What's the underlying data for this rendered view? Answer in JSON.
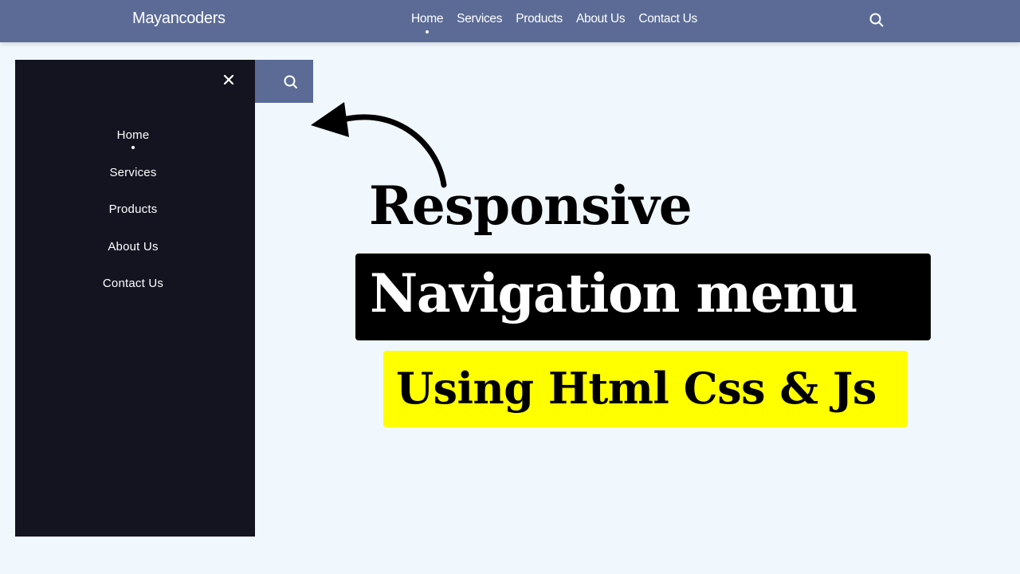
{
  "header": {
    "logo": "Mayancoders",
    "nav": [
      {
        "label": "Home",
        "active": true
      },
      {
        "label": "Services",
        "active": false
      },
      {
        "label": "Products",
        "active": false
      },
      {
        "label": "About Us",
        "active": false
      },
      {
        "label": "Contact Us",
        "active": false
      }
    ],
    "search_icon": "search-icon",
    "background": "#5b6b96"
  },
  "drawer": {
    "close_icon": "close-icon",
    "items": [
      {
        "label": "Home",
        "active": true
      },
      {
        "label": "Services",
        "active": false
      },
      {
        "label": "Products",
        "active": false
      },
      {
        "label": "About Us",
        "active": false
      },
      {
        "label": "Contact Us",
        "active": false
      }
    ],
    "search_icon": "search-icon",
    "background": "#131420"
  },
  "title": {
    "line1": "Responsive",
    "line2": "Navigation menu",
    "line3": "Using Html Css & Js",
    "highlight_color": "#ffff00",
    "dark_box_color": "#000000"
  }
}
